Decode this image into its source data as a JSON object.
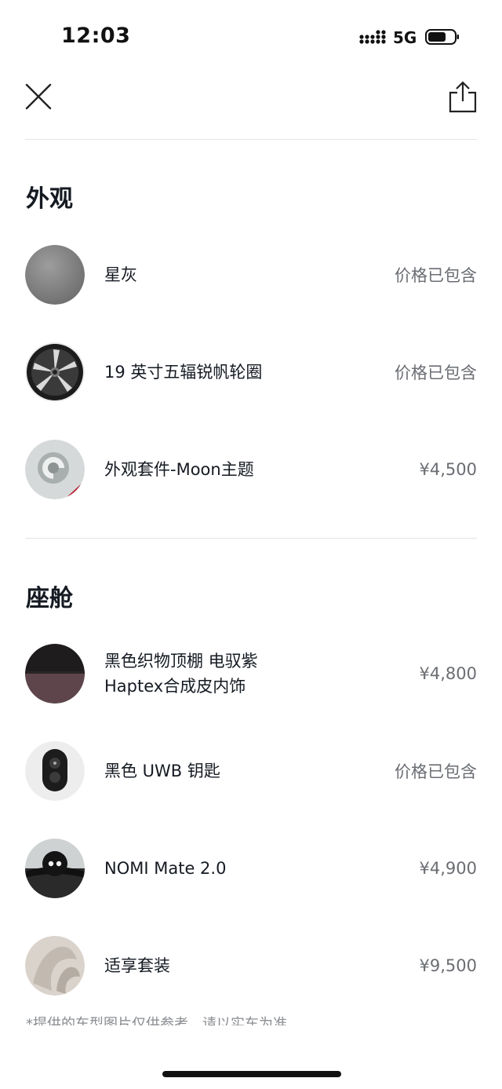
{
  "status_bar": {
    "time": "12:03",
    "network": "5G"
  },
  "sections": [
    {
      "title": "外观",
      "items": [
        {
          "name": "星灰",
          "price": "价格已包含",
          "thumb": "grey-paint-swatch"
        },
        {
          "name": "19 英寸五辐锐帆轮圈",
          "price": "价格已包含",
          "thumb": "wheel-image"
        },
        {
          "name": "外观套件-Moon主题",
          "price": "¥4,500",
          "thumb": "moon-theme-image"
        }
      ]
    },
    {
      "title": "座舱",
      "items": [
        {
          "name_line1": "黑色织物顶棚 电驭紫",
          "name_line2": "Haptex合成皮内饰",
          "price": "¥4,800",
          "thumb": "interior-swatch"
        },
        {
          "name": "黑色 UWB 钥匙",
          "price": "价格已包含",
          "thumb": "uwb-key-image"
        },
        {
          "name": "NOMI Mate 2.0",
          "price": "¥4,900",
          "thumb": "nomi-mate-image"
        },
        {
          "name": "适享套装",
          "price": "¥9,500",
          "thumb": "comfort-package-image"
        }
      ]
    }
  ],
  "footnote": "*提供的车型图片仅供参考，请以实车为准"
}
